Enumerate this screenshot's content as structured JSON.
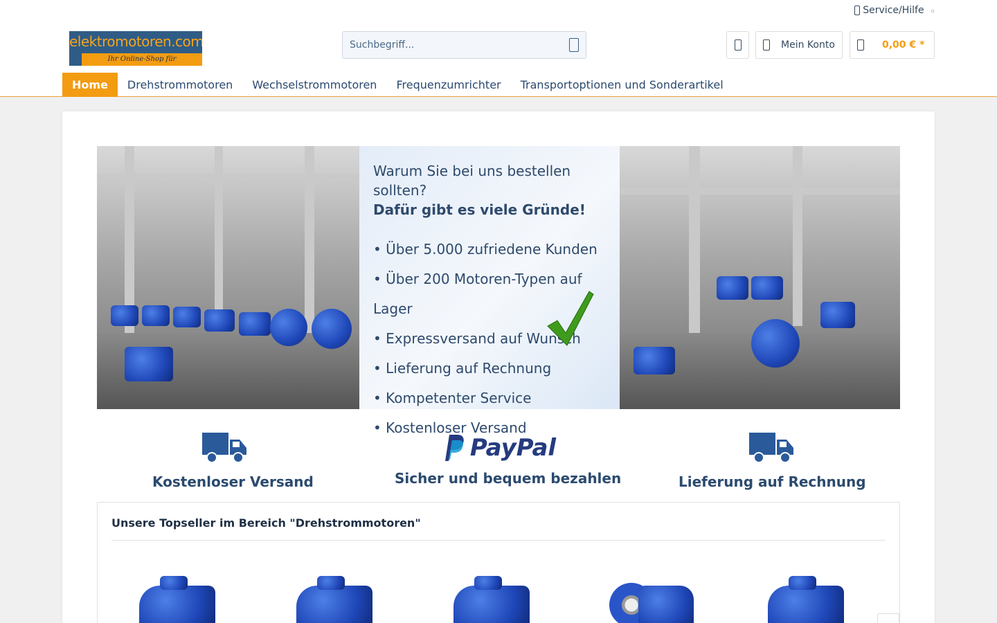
{
  "header": {
    "service_label": "Service/Hilfe",
    "logo_text": "elektromotoren.com",
    "logo_tagline": "Ihr Online-Shop für Elektromotoren",
    "search_placeholder": "Suchbegriff...",
    "account_label": "Mein Konto",
    "cart_total": "0,00 € *"
  },
  "nav": {
    "items": [
      {
        "label": "Home",
        "active": true
      },
      {
        "label": "Drehstrommotoren"
      },
      {
        "label": "Wechselstrommotoren"
      },
      {
        "label": "Frequenzumrichter"
      },
      {
        "label": "Transportoptionen und Sonderartikel"
      }
    ]
  },
  "banner": {
    "question": "Warum Sie bei uns bestellen sollten?",
    "answer": "Dafür gibt es viele Gründe!",
    "reasons": [
      "• Über 5.000 zufriedene Kunden",
      "• Über 200 Motoren-Typen auf Lager",
      "• Expressversand auf Wunsch",
      "• Lieferung auf Rechnung",
      "• Kompetenter Service",
      "• Kostenloser Versand"
    ]
  },
  "features": [
    {
      "icon": "truck-icon",
      "label": "Kostenloser Versand"
    },
    {
      "icon": "paypal-logo",
      "logo_text": "PayPal",
      "label": "Sicher und bequem bezahlen"
    },
    {
      "icon": "truck-icon",
      "label": "Lieferung auf Rechnung"
    }
  ],
  "topseller": {
    "title": "Unsere Topseller im Bereich \"Drehstrommotoren\""
  },
  "colors": {
    "accent": "#f39c12",
    "nav_text": "#2b4a6f",
    "motor_blue": "#1f47b8"
  }
}
